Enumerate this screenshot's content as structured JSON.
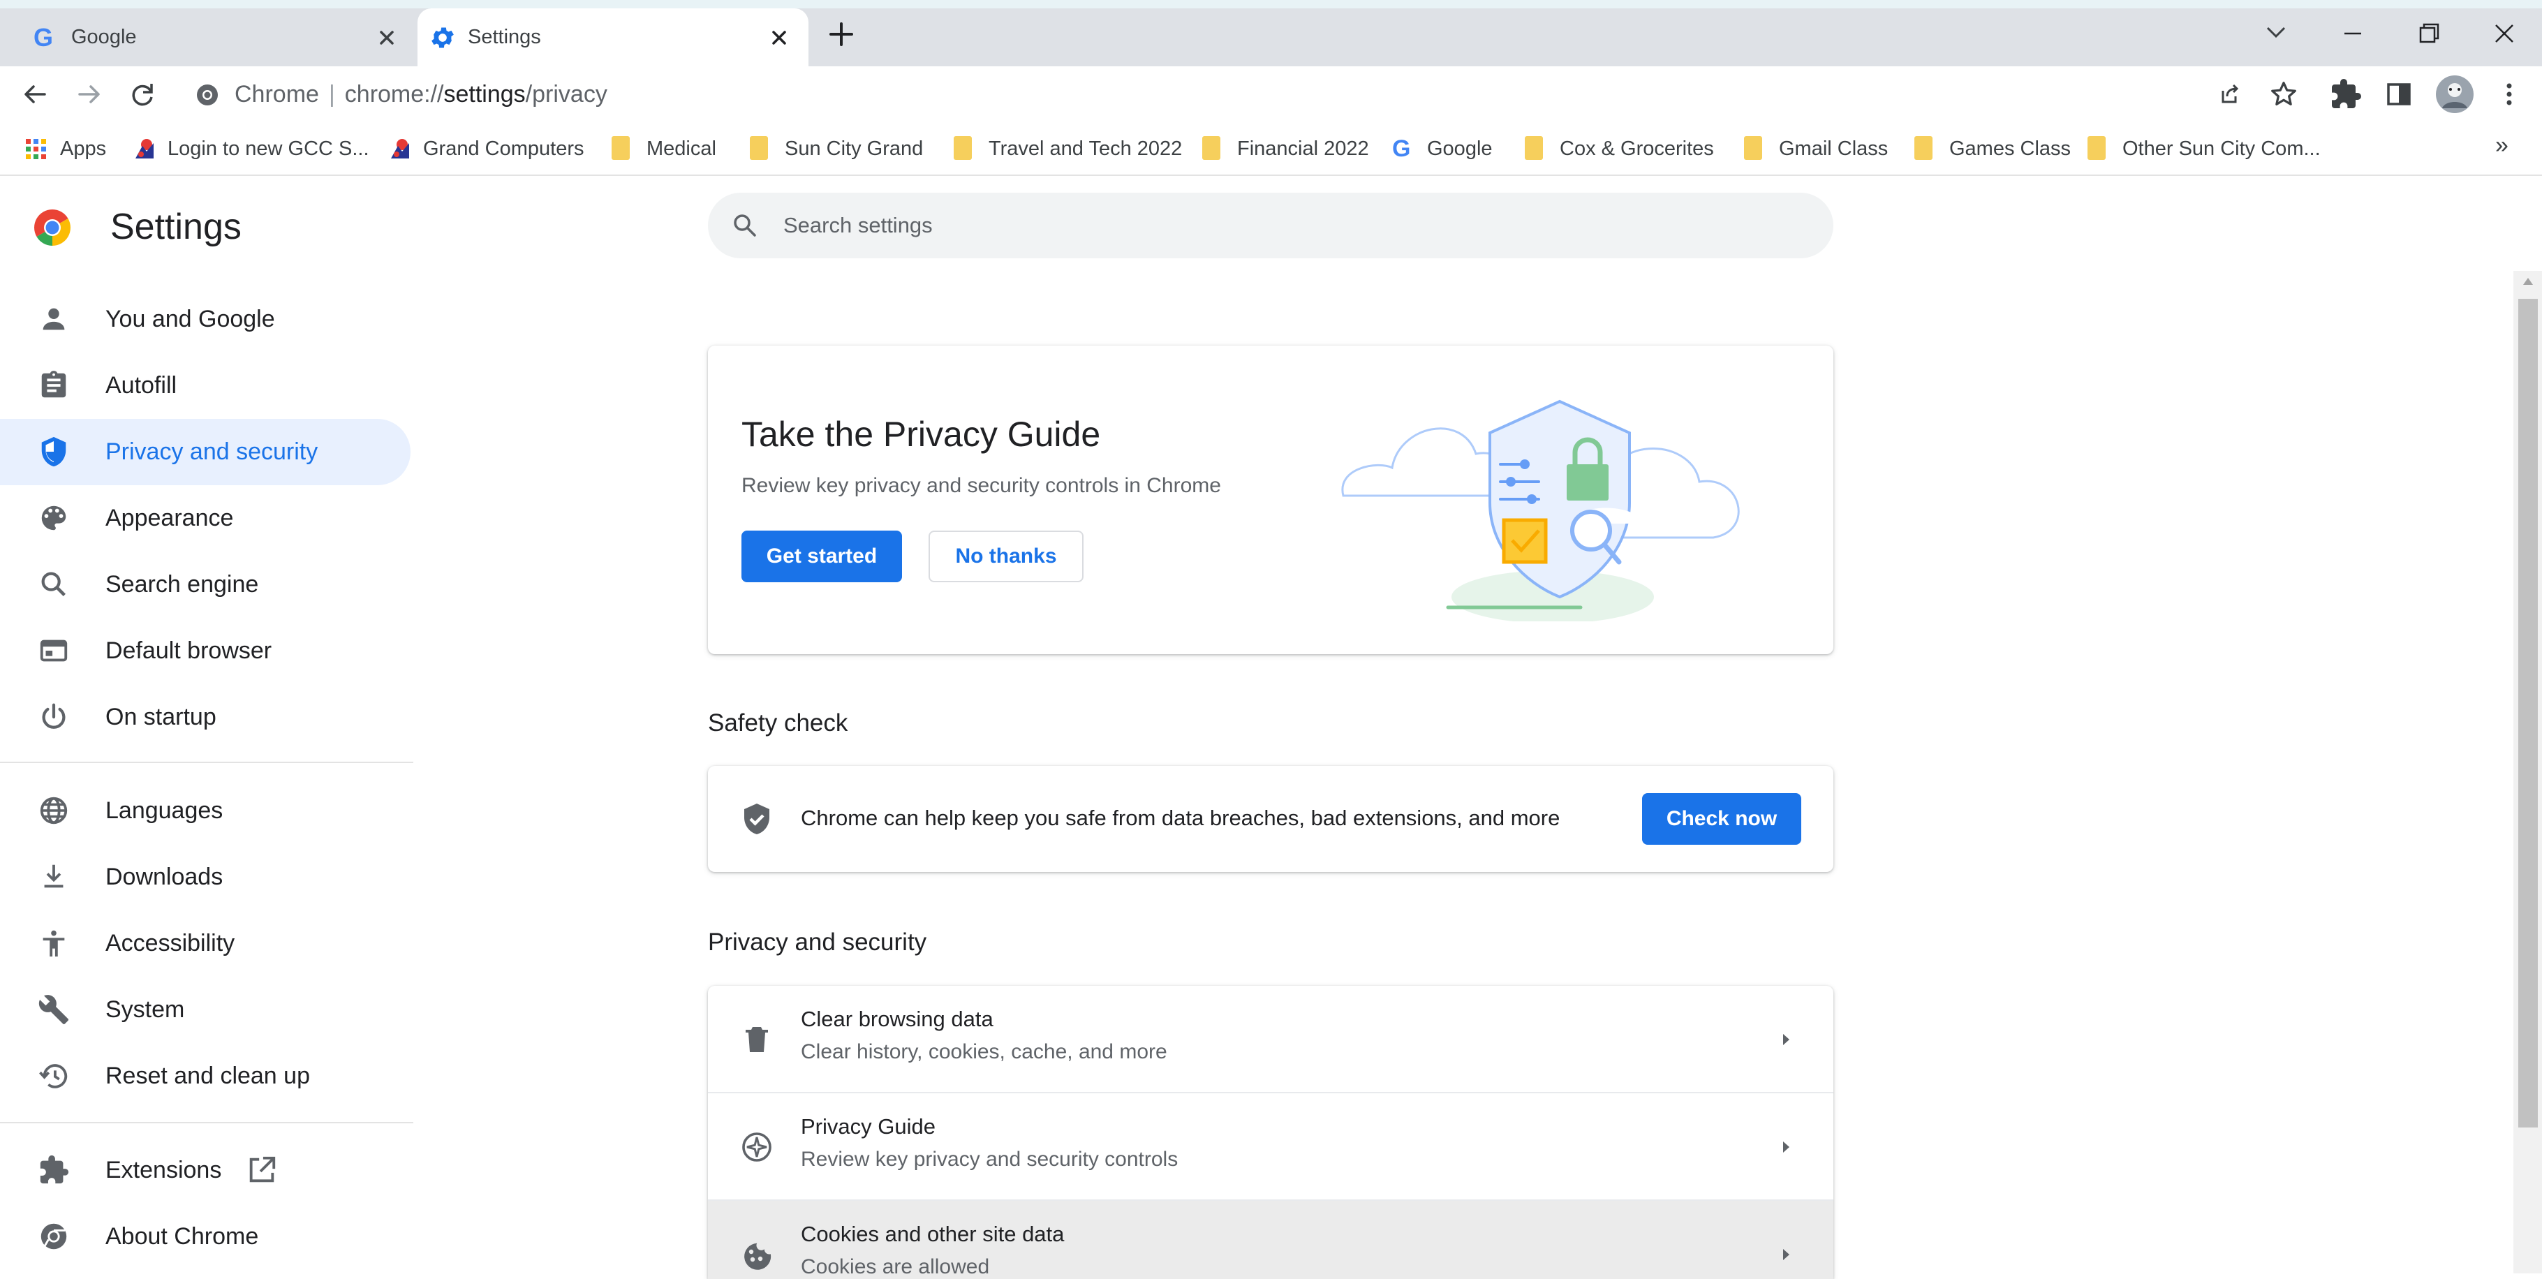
{
  "browser": {
    "tabs": [
      {
        "title": "Google",
        "favicon": "google-g-icon",
        "active": false
      },
      {
        "title": "Settings",
        "favicon": "gear-icon",
        "active": true
      }
    ],
    "new_tab_icon": "plus-icon",
    "window_controls": [
      "tab-search-icon",
      "minimize-icon",
      "restore-icon",
      "close-icon"
    ]
  },
  "toolbar": {
    "omnibox": {
      "chip": "Chrome",
      "separator": "|",
      "scheme": "chrome://",
      "host": "settings",
      "path": "/privacy"
    },
    "icons": [
      "share-icon",
      "bookmark-star-icon",
      "extensions-puzzle-icon",
      "side-panel-icon",
      "profile-avatar",
      "more-vert-icon"
    ]
  },
  "bookmarks": [
    {
      "label": "Apps",
      "icon": "apps-grid-icon"
    },
    {
      "label": "Login to new GCC S...",
      "icon": "gcc-logo-icon"
    },
    {
      "label": "Grand Computers",
      "icon": "gcc-logo-icon"
    },
    {
      "label": "Medical",
      "icon": "folder-icon"
    },
    {
      "label": "Sun City Grand",
      "icon": "folder-icon"
    },
    {
      "label": "Travel and Tech 2022",
      "icon": "folder-icon"
    },
    {
      "label": "Financial 2022",
      "icon": "folder-icon"
    },
    {
      "label": "Google",
      "icon": "google-g-icon"
    },
    {
      "label": "Cox & Grocerites",
      "icon": "folder-icon"
    },
    {
      "label": "Gmail Class",
      "icon": "folder-icon"
    },
    {
      "label": "Games Class",
      "icon": "folder-icon"
    },
    {
      "label": "Other Sun City Com...",
      "icon": "folder-icon"
    }
  ],
  "bookmarks_overflow": "»",
  "settings": {
    "title": "Settings",
    "search_placeholder": "Search settings",
    "nav": [
      {
        "label": "You and Google",
        "icon": "person-icon"
      },
      {
        "label": "Autofill",
        "icon": "clipboard-icon"
      },
      {
        "label": "Privacy and security",
        "icon": "shield-icon",
        "active": true
      },
      {
        "label": "Appearance",
        "icon": "palette-icon"
      },
      {
        "label": "Search engine",
        "icon": "search-icon"
      },
      {
        "label": "Default browser",
        "icon": "browser-window-icon"
      },
      {
        "label": "On startup",
        "icon": "power-icon"
      },
      {
        "label": "Languages",
        "icon": "globe-icon"
      },
      {
        "label": "Downloads",
        "icon": "download-icon"
      },
      {
        "label": "Accessibility",
        "icon": "accessibility-icon"
      },
      {
        "label": "System",
        "icon": "wrench-icon"
      },
      {
        "label": "Reset and clean up",
        "icon": "restore-clock-icon"
      },
      {
        "label": "Extensions",
        "icon": "puzzle-icon",
        "trailing_icon": "open-external-icon"
      },
      {
        "label": "About Chrome",
        "icon": "chrome-logo-icon"
      }
    ],
    "privacy_guide_card": {
      "title": "Take the Privacy Guide",
      "description": "Review key privacy and security controls in Chrome",
      "primary_button": "Get started",
      "secondary_button": "No thanks"
    },
    "safety_check": {
      "section_title": "Safety check",
      "text": "Chrome can help keep you safe from data breaches, bad extensions, and more",
      "button": "Check now"
    },
    "privacy_section": {
      "section_title": "Privacy and security",
      "rows": [
        {
          "title": "Clear browsing data",
          "subtitle": "Clear history, cookies, cache, and more",
          "icon": "trash-icon"
        },
        {
          "title": "Privacy Guide",
          "subtitle": "Review key privacy and security controls",
          "icon": "compass-icon"
        },
        {
          "title": "Cookies and other site data",
          "subtitle": "Cookies are allowed",
          "icon": "cookie-icon",
          "highlighted": true
        }
      ]
    }
  },
  "colors": {
    "accent": "#1a73e8",
    "active_nav_bg": "#e8f0fe",
    "tabstrip_bg": "#dee1e6",
    "search_bg": "#f1f3f4",
    "folder": "#f6cf5c"
  }
}
